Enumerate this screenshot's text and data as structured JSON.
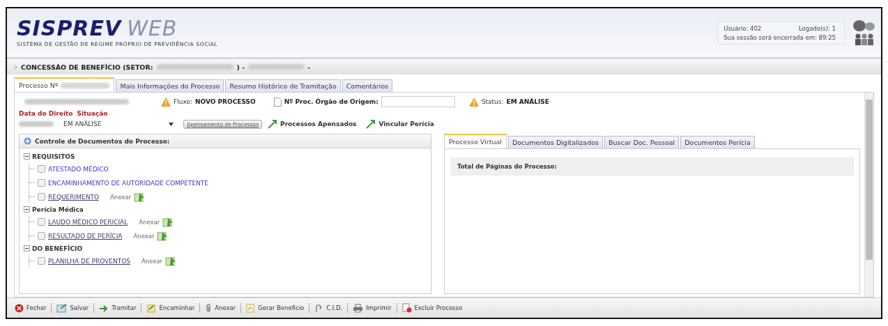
{
  "header": {
    "logo": "SISPREV",
    "logo_suffix": "WEB",
    "tagline": "SISTEMA DE GESTÃO DE REGIME PRÓPRIO DE PREVIDÊNCIA SOCIAL",
    "user_label": "Usuário: 402",
    "logged_label": "Logado(s): 1",
    "session_label": "Sua sessão será encerrada em: 89:25"
  },
  "section_title": "CONCESSÃO DE BENEFÍCIO (SETOR:",
  "section_sep": ") -",
  "section_end": "-",
  "tabs": [
    {
      "label": "Processo Nº",
      "selected": true
    },
    {
      "label": "Mais Informações do Processo",
      "selected": false
    },
    {
      "label": "Resumo Histórico de Tramitação",
      "selected": false
    },
    {
      "label": "Comentários",
      "selected": false
    }
  ],
  "process": {
    "flow_label": "Fluxo:",
    "flow_value": "NOVO PROCESSO",
    "origin_label": "Nº Proc. Órgão de Origem:",
    "status_label": "Status:",
    "status_value": "EM ANÁLISE",
    "date_label": "Data do Direito",
    "situation_label": "Situação",
    "situation_value": "EM ANÁLISE",
    "attach_button": "Apensamento de Processos",
    "attached_link": "Processos Apensados",
    "link_perícia": "Vincular Perícia"
  },
  "documents": {
    "title": "Controle de Documentos do Processo:",
    "groups": [
      {
        "label": "REQUISITOS",
        "expanded": true,
        "children": [
          {
            "label": "ATESTADO MÉDICO",
            "checked": false,
            "attached": false
          },
          {
            "label": "ENCAMINHAMENTO DE AUTORIDADE COMPETENTE",
            "checked": false,
            "attached": false
          },
          {
            "label": "REQUERIMENTO",
            "checked": false,
            "attached": true,
            "action": "Anexar"
          }
        ]
      },
      {
        "label": "Perícia Médica",
        "expanded": true,
        "children": [
          {
            "label": "LAUDO MÉDICO PERICIAL",
            "checked": false,
            "attached": true,
            "action": "Anexar"
          },
          {
            "label": "RESULTADO DE PERÍCIA",
            "checked": false,
            "attached": true,
            "action": "Anexar"
          }
        ]
      },
      {
        "label": "DO BENEFÍCIO",
        "expanded": true,
        "children": [
          {
            "label": "PLANILHA DE PROVENTOS",
            "checked": false,
            "attached": true,
            "action": "Anexar"
          }
        ]
      }
    ]
  },
  "viewer_tabs": [
    {
      "label": "Processo Virtual",
      "selected": true
    },
    {
      "label": "Documentos Digitalizados",
      "selected": false
    },
    {
      "label": "Buscar Doc. Pessoal",
      "selected": false
    },
    {
      "label": "Documentos Perícia",
      "selected": false
    }
  ],
  "viewer": {
    "pages_label": "Total de Páginas do Processo:"
  },
  "toolbar": [
    {
      "label": "Fechar",
      "kind": "close"
    },
    {
      "label": "Salvar",
      "kind": "save"
    },
    {
      "label": "Tramitar",
      "kind": "forward"
    },
    {
      "label": "Encaminhar",
      "kind": "send"
    },
    {
      "label": "Anexar",
      "kind": "clip"
    },
    {
      "label": "Gerar Benefício",
      "kind": "doc"
    },
    {
      "label": "C.I.D.",
      "kind": "cid"
    },
    {
      "label": "Imprimir",
      "kind": "print"
    },
    {
      "label": "Excluir Processo",
      "kind": "delete"
    }
  ]
}
